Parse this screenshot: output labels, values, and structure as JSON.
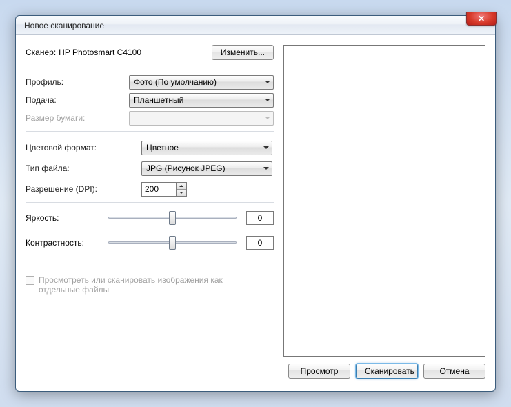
{
  "window": {
    "title": "Новое сканирование"
  },
  "scanner": {
    "label": "Сканер:",
    "name": "HP Photosmart C4100",
    "change_btn": "Изменить..."
  },
  "profile": {
    "label": "Профиль:",
    "value": "Фото (По умолчанию)"
  },
  "source": {
    "label": "Подача:",
    "value": "Планшетный"
  },
  "paper_size": {
    "label": "Размер бумаги:",
    "value": ""
  },
  "color_format": {
    "label": "Цветовой формат:",
    "value": "Цветное"
  },
  "file_type": {
    "label": "Тип файла:",
    "value": "JPG (Рисунок JPEG)"
  },
  "resolution": {
    "label": "Разрешение (DPI):",
    "value": "200"
  },
  "brightness": {
    "label": "Яркость:",
    "value": "0"
  },
  "contrast": {
    "label": "Контрастность:",
    "value": "0"
  },
  "separate_files": {
    "label": "Просмотреть или сканировать изображения как отдельные файлы"
  },
  "buttons": {
    "preview": "Просмотр",
    "scan": "Сканировать",
    "cancel": "Отмена"
  }
}
